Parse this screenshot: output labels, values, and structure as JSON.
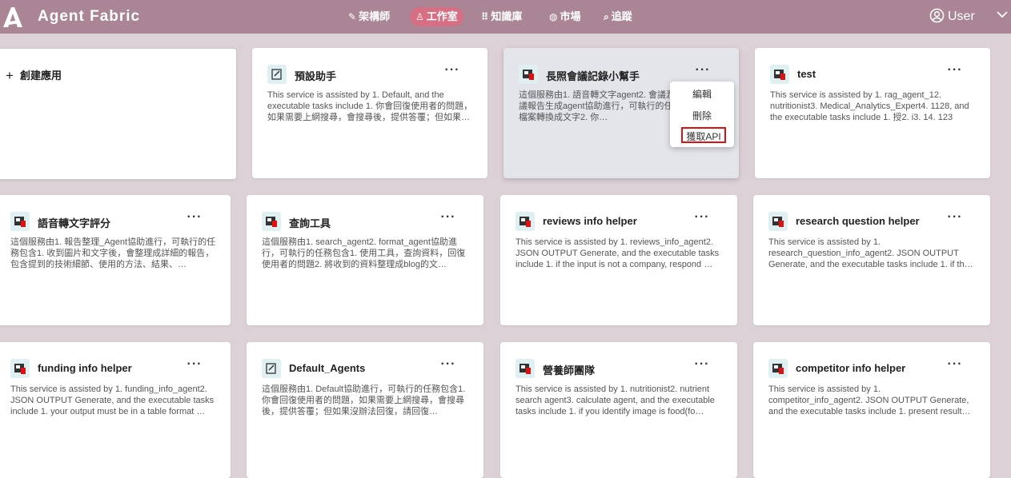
{
  "app": {
    "title": "Agent Fabric",
    "logo_icon": "logo-icon"
  },
  "nav": [
    {
      "label": "架構師",
      "icon": "wand-icon"
    },
    {
      "label": "工作室",
      "icon": "studio-icon",
      "active": true
    },
    {
      "label": "知識庫",
      "icon": "grid-icon"
    },
    {
      "label": "市場",
      "icon": "globe-icon"
    },
    {
      "label": "追蹤",
      "icon": "search-icon"
    }
  ],
  "user": {
    "label": "User"
  },
  "create_card": {
    "label": "創建應用"
  },
  "more_label": "···",
  "cards": [
    {
      "title": "預設助手",
      "desc": "This service is assisted by 1. Default, and the executable tasks include 1. 你會回復使用者的問題，如果需要上網搜尋，會搜尋後，提供答覆；但如果…",
      "icon": "doc-icon"
    },
    {
      "title": "長照會議記錄小幫手",
      "desc": "這個服務由1. 語音轉文字agent2. 會議潤飾agent3. 會議報告生成agent協助進行，可執行的任務包含1. 將檔案轉換成文字2. 你…",
      "icon": "app-icon"
    },
    {
      "title": "test",
      "desc": "This service is assisted by 1. rag_agent_12. nutritionist3. Medical_Analytics_Expert4. 1128, and the executable tasks include 1. 授2. i3. 14. 123",
      "icon": "app-icon"
    },
    {
      "title": "語音轉文字評分",
      "desc": "這個服務由1. 報告整理_Agent協助進行，可執行的任務包含1. 收到圖片和文字後，會整理成詳細的報告，包含提到的技術細節、使用的方法、結果、…",
      "icon": "app-icon"
    },
    {
      "title": "查詢工具",
      "desc": "這個服務由1. search_agent2. format_agent協助進行，可執行的任務包含1. 使用工具，查詢資料，回復使用者的問題2. 將收到的資料整理成blog的文…",
      "icon": "app-icon"
    },
    {
      "title": "reviews info helper",
      "desc": "This service is assisted by 1. reviews_info_agent2. JSON OUTPUT Generate, and the executable tasks include 1. if the input is not a company, respond …",
      "icon": "app-icon"
    },
    {
      "title": "research question helper",
      "desc": "This service is assisted by 1. research_question_info_agent2. JSON OUTPUT Generate, and the executable tasks include 1. if the input is not a compa…",
      "icon": "app-icon"
    },
    {
      "title": "funding info helper",
      "desc": "This service is assisted by 1. funding_info_agent2. JSON OUTPUT Generate, and the executable tasks include 1. your output must be in a table format …",
      "icon": "app-icon"
    },
    {
      "title": "Default_Agents",
      "desc": "這個服務由1. Default協助進行，可執行的任務包含1. 你會回復使用者的問題，如果需要上網搜尋，會搜尋後，提供答覆；但如果沒辦法回復，請回復…",
      "icon": "doc-icon"
    },
    {
      "title": "營養師團隊",
      "desc": "This service is assisted by 1. nutritionist2. nutrient search agent3. calculate agent, and the executable tasks include 1. if you identify image is food(fo…",
      "icon": "app-icon"
    },
    {
      "title": "competitor info helper",
      "desc": "This service is assisted by 1. competitor_info_agent2. JSON OUTPUT Generate, and the executable tasks include 1. present results in a table format …",
      "icon": "app-icon"
    }
  ],
  "context_menu": {
    "edit": "編輯",
    "delete": "刪除",
    "get_api": "獲取API"
  },
  "colors": {
    "header": "#a98595",
    "active_tab": "#d66f84",
    "background": "#dcd1d6",
    "highlight_border": "#dd1111"
  }
}
